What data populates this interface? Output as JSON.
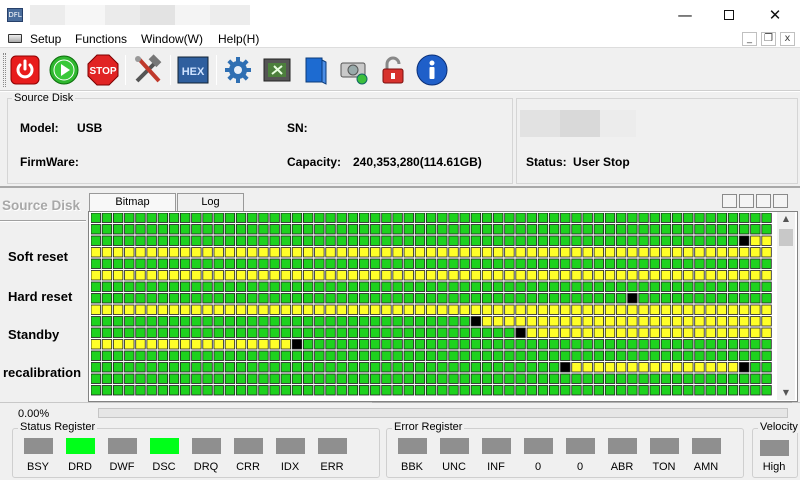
{
  "menu": {
    "items": [
      "Setup",
      "Functions",
      "Window(W)",
      "Help(H)"
    ]
  },
  "toolbar": {
    "icons": [
      "power-icon",
      "play-icon",
      "stop-icon",
      "tools-icon",
      "hex-icon",
      "gear-icon",
      "erase-icon",
      "book-icon",
      "disk-icon",
      "lock-icon",
      "info-icon"
    ],
    "stop_label": "STOP",
    "hex_label": "HEX"
  },
  "source_disk": {
    "legend": "Source Disk",
    "model_label": "Model:",
    "model": "USB",
    "sn_label": "SN:",
    "sn": "",
    "firmware_label": "FirmWare:",
    "firmware": "",
    "capacity_label": "Capacity:",
    "capacity": "240,353,280(114.61GB)",
    "status_label": "Status:",
    "status": "User Stop"
  },
  "side_panel": {
    "title": "Source Disk",
    "buttons": [
      "Soft reset",
      "Hard reset",
      "Standby",
      "recalibration"
    ]
  },
  "tabs": [
    "Bitmap",
    "Log"
  ],
  "bitmap": {
    "colors": {
      "good": "#1ed21e",
      "pending": "#ffff28",
      "bad": "#000000",
      "border": "#202020"
    },
    "rows": [
      "GGGGGGGGGGGGGGGGGGGGGGGGGGGGGGGGGGGGGGGGGGGGGGGGGGGGGGGGGGGGGGGGGGG",
      "GGGGGGGGGGGGGGGGGGGGGGGGGGGGGGGGGGGGGGGGGGGGGGGGGGGGGGGGGGGGGGGGGGG",
      "GGGGGGGGGGGGGGGGGGGGGGGGGGGGGGGGGGGGGGGGGGGGGGGGGGGGGGGGGGBYYYYYYYYYYYYYYYY",
      "YYYYYYYYYYYYYYYYYYYYYYYYYYYYYYYYYYYYYYYYYYYYYYYYYYYYYYYYYYYYYYYYYYYY",
      "GGGGGGGGGGGGGGGGGGGGGGGGGGGGGGGGGGGGGGGGGGGGGGGGGGGGGGGGGGGGGGGGGBYYYYYYYYY",
      "YYYYYYYYYYYYYYYYYYYYYYYYYYYYYYYYYYYYYYYYYYYYYYYYYYYYYYYYYYYYYYYYYYYYBGGGGGGGG",
      "GGGGGGGGGGGGGGGGGGGGGGGGGGGGGGGGGGGGGGGGGGGGGGGGGGGGGGGGGGGGGGGGGGGG",
      "GGGGGGGGGGGGGGGGGGGGGGGGGGGGGGGGGGGGGGGGGGGGGGGGBGGGGGGGGGGGGGGGGGGG",
      "YYYYYYYYYYYYYYYYYYYYYYYYYYYYYYYYYYYYYYYYYYYYYYYYYYYYYYYYYYYYYYYYYYYY",
      "GGGGGGGGGGGGGGGGGGGGGGGGGGGGGGGGGGBYYYYYYYYYYYYYYYYYYYYYYYYYYYYYYYYYYY",
      "GGGGGGGGGGGGGGGGGGGGGGGGGGGGGGGGGGGGGGBYYYYYYYYYYYYYYYYYYYYYYYYYYYYYYY",
      "YYYYYYYYYYYYYYYYYYBGGGGGGGGGGGGGGGGGGGGGGGGGGGGGGGGGGGGGGGGGGGGGGGGGG",
      "GGGGGGGGGGGGGGGGGGGGGGGGGGGGGGGGGGGGGGGGGGGGGGGGGGGGGGGGGGGGGGGGGGGGGG",
      "GGGGGGGGGGGGGGGGGGGGGGGGGGGGGGGGGGGGGGGGGGBYYYYYYYYYYYYYYYBGGGGGGGGGGGGGGGG",
      "GGGGGGGGGGGGGGGGGGGGGGGGGGGGGGGGGGGGGGGGGGGGGGGGGGGGGGGGGGGGGGGGGGGGG",
      "GGGGGGGGGGGGGGGGGGGGGGGGGGGGGGGGGGGGGGGGGGGGGGGGGGGGGGGGGGGGGGGGGGGGG"
    ]
  },
  "progress": {
    "label": "0.00%",
    "fraction": 0.0
  },
  "status_register": {
    "legend": "Status Register",
    "items": [
      {
        "label": "BSY",
        "on": false
      },
      {
        "label": "DRD",
        "on": true
      },
      {
        "label": "DWF",
        "on": false
      },
      {
        "label": "DSC",
        "on": true
      },
      {
        "label": "DRQ",
        "on": false
      },
      {
        "label": "CRR",
        "on": false
      },
      {
        "label": "IDX",
        "on": false
      },
      {
        "label": "ERR",
        "on": false
      }
    ]
  },
  "error_register": {
    "legend": "Error Register",
    "items": [
      {
        "label": "BBK",
        "on": false
      },
      {
        "label": "UNC",
        "on": false
      },
      {
        "label": "INF",
        "on": false
      },
      {
        "label": "0",
        "on": false
      },
      {
        "label": "0",
        "on": false
      },
      {
        "label": "ABR",
        "on": false
      },
      {
        "label": "TON",
        "on": false
      },
      {
        "label": "AMN",
        "on": false
      }
    ]
  },
  "velocity": {
    "legend": "Velocity",
    "value": "High"
  }
}
